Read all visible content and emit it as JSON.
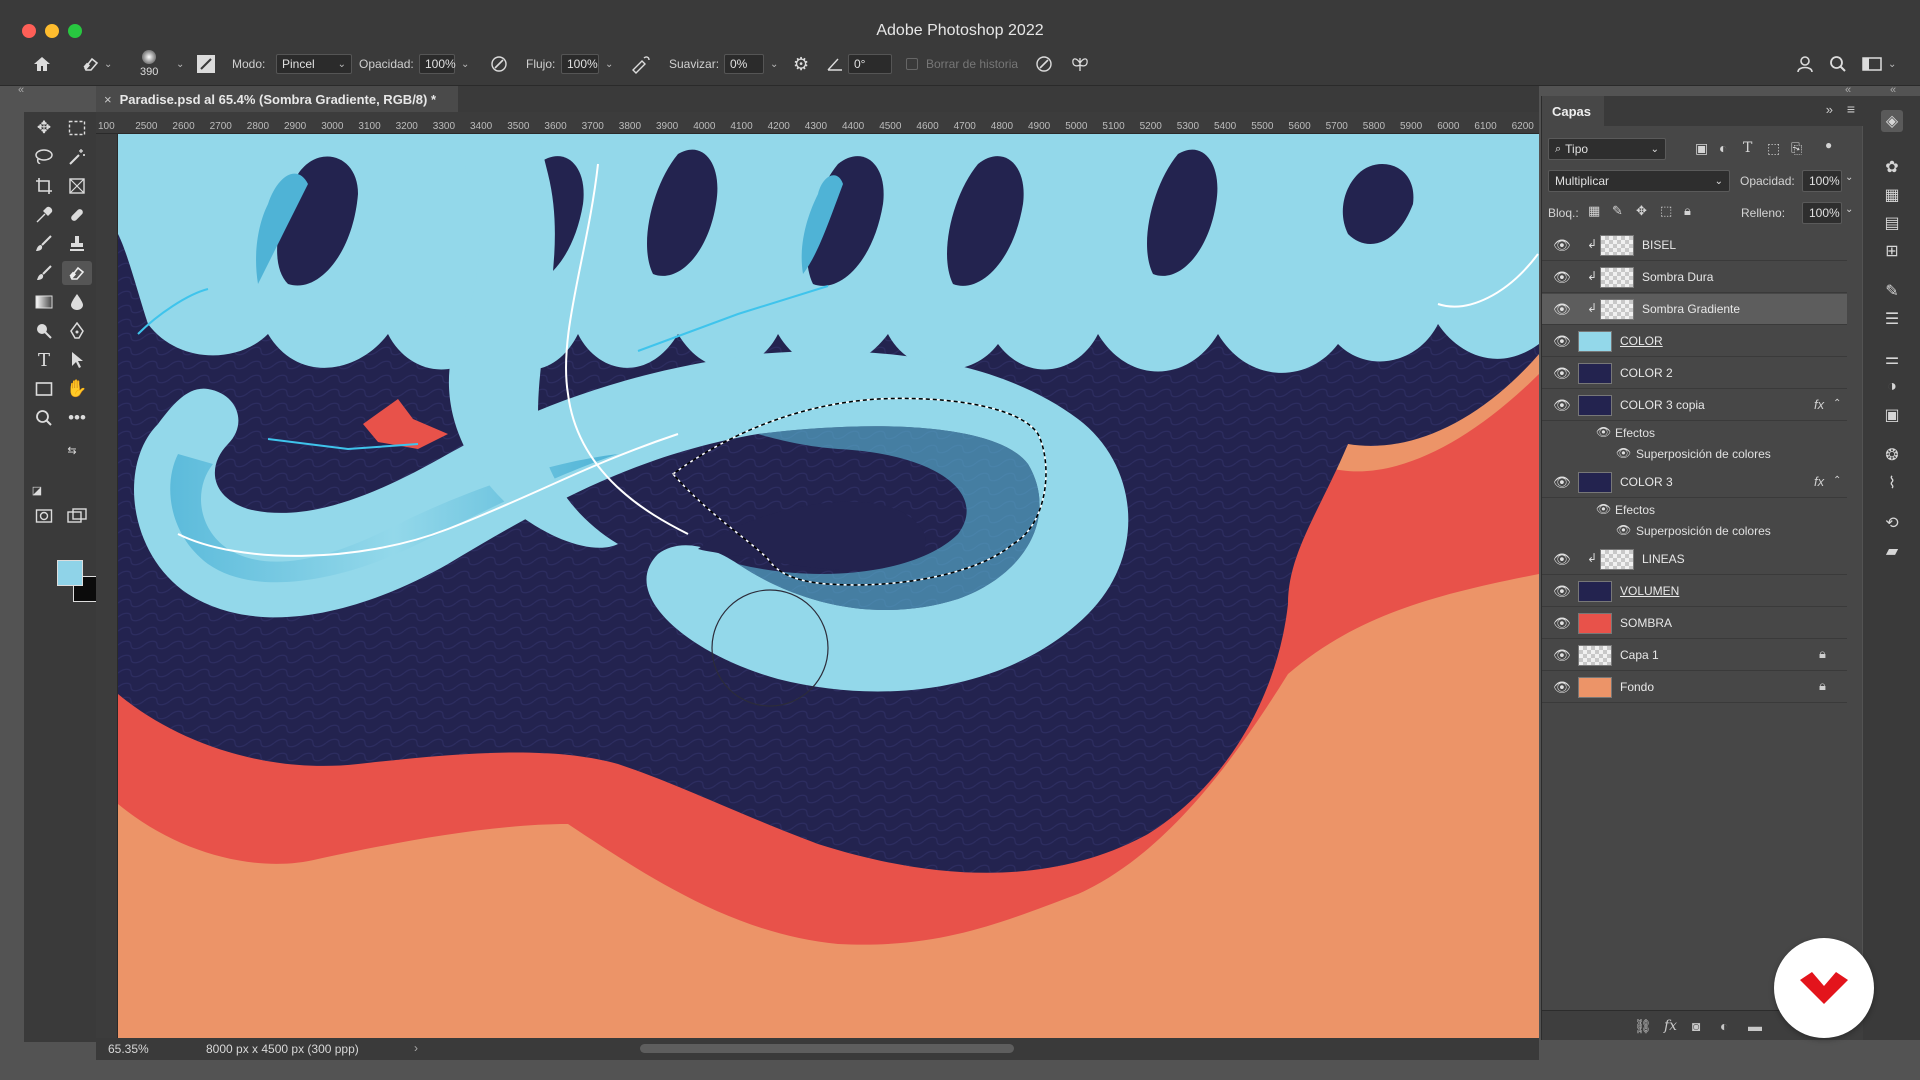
{
  "window": {
    "title": "Adobe Photoshop 2022"
  },
  "options_bar": {
    "brush_size": "390",
    "mode_label": "Modo:",
    "mode_value": "Pincel",
    "opacity_label": "Opacidad:",
    "opacity_value": "100%",
    "flow_label": "Flujo:",
    "flow_value": "100%",
    "smoothing_label": "Suavizar:",
    "smoothing_value": "0%",
    "angle_value": "0°",
    "erase_history_label": "Borrar de historia"
  },
  "document_tab": {
    "close_glyph": "×",
    "title": "Paradise.psd al 65.4% (Sombra Gradiente, RGB/8) *"
  },
  "ruler_ticks": [
    "100",
    "2500",
    "2600",
    "2700",
    "2800",
    "2900",
    "3000",
    "3100",
    "3200",
    "3300",
    "3400",
    "3500",
    "3600",
    "3700",
    "3800",
    "3900",
    "4000",
    "4100",
    "4200",
    "4300",
    "4400",
    "4500",
    "4600",
    "4700",
    "4800",
    "4900",
    "5000",
    "5100",
    "5200",
    "5300",
    "5400",
    "5500",
    "5600",
    "5700",
    "5800",
    "5900",
    "6000",
    "6100",
    "6200"
  ],
  "status_bar": {
    "zoom": "65.35%",
    "doc_size": "8000 px x 4500 px (300 ppp)"
  },
  "layers_panel": {
    "title": "Capas",
    "filter_value": "Tipo",
    "blend_mode": "Multiplicar",
    "opacity_label": "Opacidad:",
    "opacity_value": "100%",
    "lock_label": "Bloq.:",
    "fill_label": "Relleno:",
    "fill_value": "100%",
    "layers": [
      {
        "name": "BISEL",
        "clipped": true,
        "thumb": "checker",
        "selected": false
      },
      {
        "name": "Sombra Dura",
        "clipped": true,
        "thumb": "checker",
        "selected": false
      },
      {
        "name": "Sombra Gradiente",
        "clipped": true,
        "thumb": "checker",
        "selected": true
      },
      {
        "name": "COLOR",
        "clipped": false,
        "thumb": "lightblue",
        "selected": false,
        "underline": true
      },
      {
        "name": "COLOR 2",
        "clipped": false,
        "thumb": "navy",
        "selected": false
      },
      {
        "name": "COLOR 3 copia",
        "clipped": false,
        "thumb": "navy",
        "selected": false,
        "fx": true,
        "effects_label": "Efectos",
        "effects": [
          "Superposición de colores"
        ]
      },
      {
        "name": "COLOR 3",
        "clipped": false,
        "thumb": "navy",
        "selected": false,
        "fx": true,
        "effects_label": "Efectos",
        "effects": [
          "Superposición de colores"
        ]
      },
      {
        "name": "LINEAS",
        "clipped": true,
        "thumb": "checker",
        "selected": false
      },
      {
        "name": "VOLUMEN",
        "clipped": false,
        "thumb": "navy",
        "selected": false,
        "underline": true
      },
      {
        "name": "SOMBRA",
        "clipped": false,
        "thumb": "red",
        "selected": false
      },
      {
        "name": "Capa 1",
        "clipped": false,
        "thumb": "checker",
        "selected": false,
        "locked": true
      },
      {
        "name": "Fondo",
        "clipped": false,
        "thumb": "orange",
        "selected": false,
        "locked": true
      }
    ]
  },
  "colors": {
    "foreground": "#8fd3e8",
    "background": "#0b0b0b",
    "canvas_orange": "#ec9468",
    "canvas_red": "#e8524a",
    "canvas_navy": "#23234f",
    "canvas_lightblue": "#93d8ea",
    "canvas_midblue": "#4fb3d6",
    "brand_red": "#e3141c"
  }
}
